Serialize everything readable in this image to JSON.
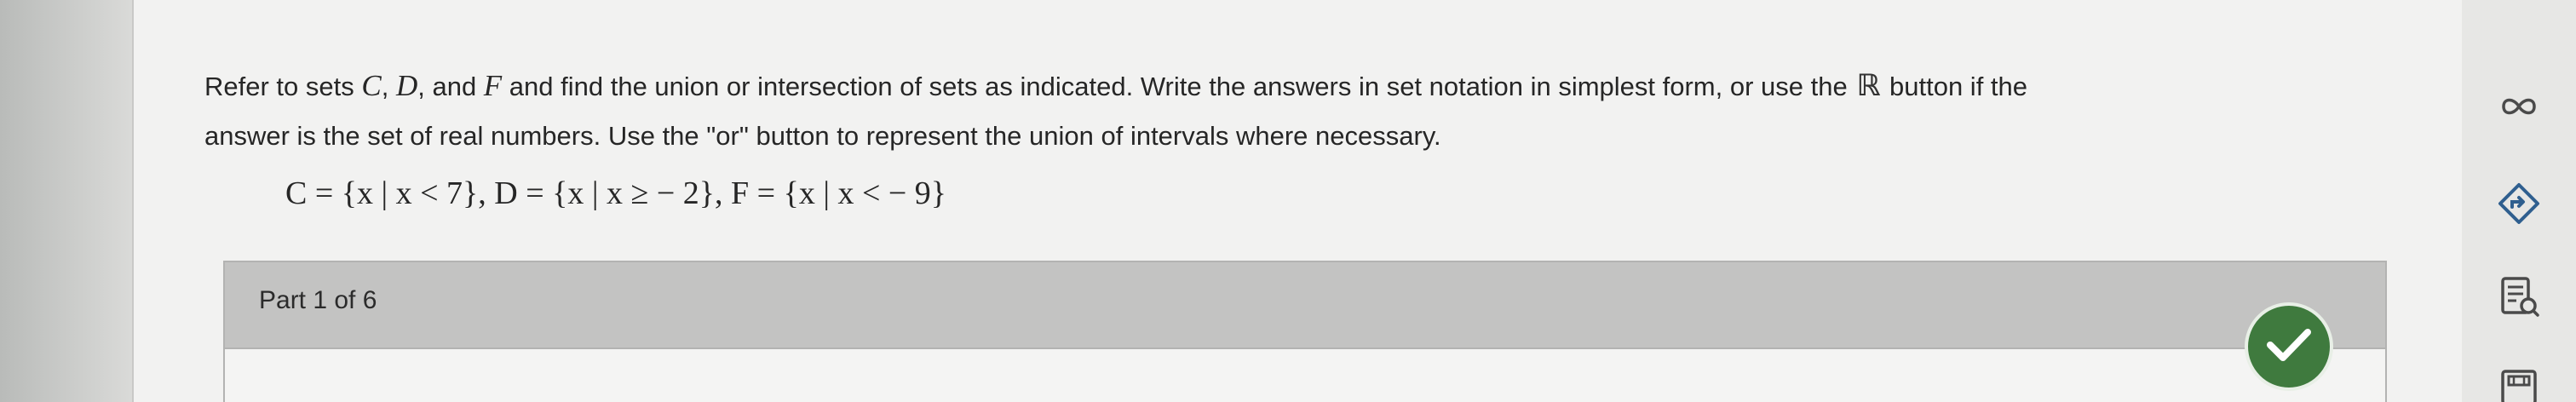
{
  "question": {
    "line1_a": "Refer to sets ",
    "set_c": "C",
    "sep1": ", ",
    "set_d": "D",
    "sep2": ", and ",
    "set_f": "F",
    "line1_b": " and find the union or intersection of sets as indicated. Write the answers in set notation in simplest form, or use the ",
    "real_symbol": "ℝ",
    "line1_c": " button if the",
    "line2": "answer is the set of real numbers. Use the \"or\" button to represent the union of intervals where necessary.",
    "sets_definition": "C = {x | x < 7}, D = {x | x ≥ − 2}, F = {x | x < − 9}"
  },
  "part": {
    "label": "Part 1 of 6"
  },
  "status": {
    "complete_color": "#3f7a3e"
  },
  "right_toolbar": {
    "icons": [
      "infinity-icon",
      "navigate-diamond-icon",
      "search-document-icon",
      "calculator-icon"
    ]
  }
}
